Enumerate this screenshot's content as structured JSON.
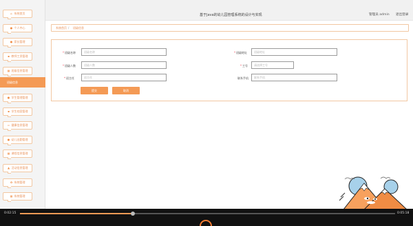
{
  "header": {
    "title": "基于Java的幼儿园管理系统的设计与实现",
    "user": "管理员 admin",
    "logout": "退出登录"
  },
  "sidebar": {
    "items": [
      {
        "label": "系统首页",
        "icon": "home-icon"
      },
      {
        "label": "个人中心",
        "icon": "user-icon"
      },
      {
        "label": "家长管理",
        "icon": "people-icon"
      },
      {
        "label": "教师工资管理",
        "icon": "wallet-icon"
      },
      {
        "label": "班级信息管理",
        "icon": "grid-icon"
      },
      {
        "label": "班级信息",
        "icon": "grid-icon",
        "active": true
      },
      {
        "label": "学生管理管理",
        "icon": "user-icon"
      },
      {
        "label": "学生档案管理",
        "icon": "folder-icon"
      },
      {
        "label": "健康信息管理",
        "icon": "heart-icon"
      },
      {
        "label": "幼儿出勤管理",
        "icon": "user-icon"
      },
      {
        "label": "课程信息管理",
        "icon": "grid-icon"
      },
      {
        "label": "活动信息管理",
        "icon": "flag-icon"
      },
      {
        "label": "系统管理",
        "icon": "gear-icon"
      },
      {
        "label": "系统管理",
        "icon": "grid-icon"
      }
    ]
  },
  "breadcrumb": {
    "home": "系统首页",
    "current": "班级信息"
  },
  "form": {
    "class_name": {
      "label": "班级名称",
      "placeholder": "班级名称",
      "required": true
    },
    "class_address": {
      "label": "班级地址",
      "placeholder": "班级地址",
      "required": true
    },
    "class_size": {
      "label": "班级人数",
      "placeholder": "班级人数",
      "required": true
    },
    "teacher_id": {
      "label": "工号",
      "placeholder": "请选择工号",
      "required": true
    },
    "head_teacher": {
      "label": "班主任",
      "placeholder": "班主任",
      "required": true
    },
    "phone": {
      "label": "联系手机",
      "placeholder": "联系手机",
      "required": false
    },
    "submit_label": "提交",
    "cancel_label": "取消"
  },
  "video": {
    "elapsed": "0:02:15",
    "duration": "0:05:18",
    "progress": 0.3
  },
  "colors": {
    "accent": "#f49a55",
    "accent_border": "#f2c7a1",
    "sidebar_bg": "#f4f4f4"
  }
}
